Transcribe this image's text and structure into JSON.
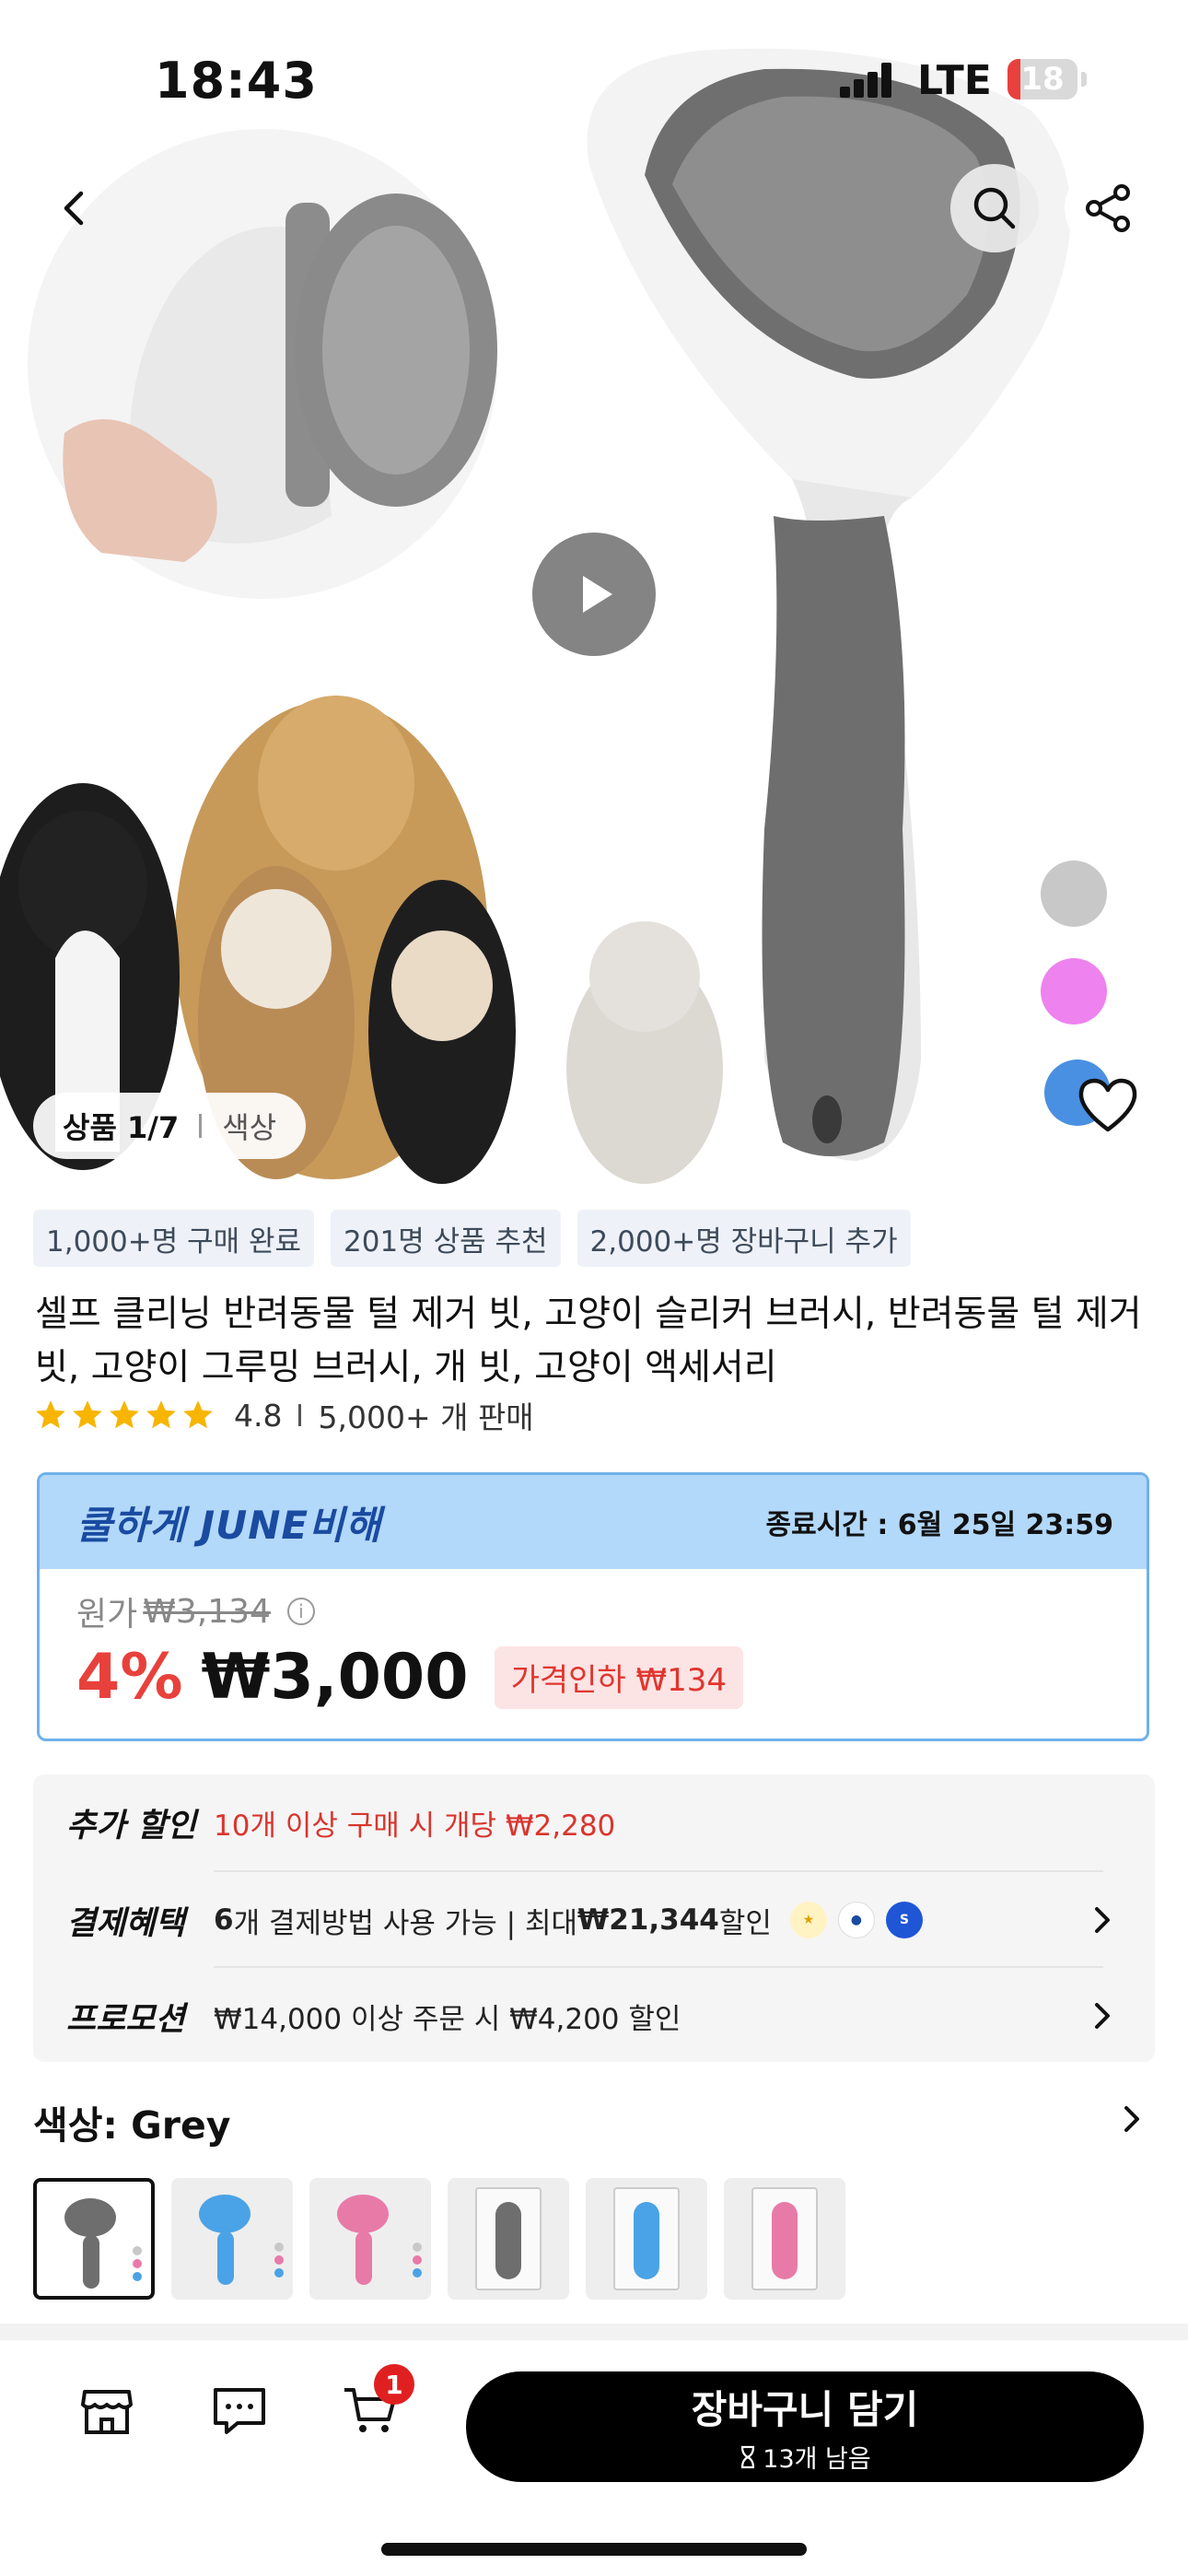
{
  "status_bar": {
    "time": "18:43",
    "network": "LTE",
    "battery": "18",
    "battery_level": 0.18
  },
  "hero": {
    "counter_label": "상품 1/7",
    "counter_sub": "색상",
    "color_options": [
      "#c8c8c8",
      "#ee82ee",
      "#4a90e2"
    ]
  },
  "tags": [
    "1,000+명 구매 완료",
    "201명 상품 추천",
    "2,000+명 장바구니 추가"
  ],
  "product": {
    "title": "셀프 클리닝 반려동물 털 제거 빗, 고양이 슬리커 브러시, 반려동물 털 제거 빗, 고양이 그루밍 브러시, 개 빗, 고양이 액세서리",
    "rating": "4.8",
    "rating_stars": 5,
    "sold": "5,000+ 개 판매"
  },
  "deal": {
    "brand": "쿨하게 JUNE비해",
    "end_time": "종료시간 : 6월 25일 23:59",
    "original_label": "원가",
    "original_price": "₩3,134",
    "discount_pct": "4%",
    "price": "₩3,000",
    "price_drop": "가격인하 ₩134"
  },
  "benefits": {
    "extra_label": "추가 할인",
    "extra_text": "10개 이상 구매 시 개당 ₩2,280",
    "payment_label": "결제혜택",
    "payment_count": "6",
    "payment_text": "개 결제방법 사용 가능 | 최대 ",
    "payment_max": "₩21,344",
    "payment_suffix": " 할인",
    "promo_label": "프로모션",
    "promo_text": "₩14,000 이상 주문 시 ₩4,200 할인"
  },
  "color": {
    "label": "색상: Grey",
    "swatches": [
      {
        "name": "grey",
        "color": "#6e6e6e"
      },
      {
        "name": "blue",
        "color": "#4aa3e6"
      },
      {
        "name": "pink",
        "color": "#e87aa8"
      },
      {
        "name": "grey-box",
        "color": "#6e6e6e"
      },
      {
        "name": "blue-box",
        "color": "#4aa3e6"
      },
      {
        "name": "pink-box",
        "color": "#e87aa8"
      }
    ]
  },
  "bottom_bar": {
    "cart_count": "1",
    "add_cart_label": "장바구니 담기",
    "stock_left": "13개 남음"
  },
  "colors": {
    "accent_blue": "#b2d8fa",
    "price_red": "#e8413c",
    "brand_blue": "#1a4ba0"
  }
}
